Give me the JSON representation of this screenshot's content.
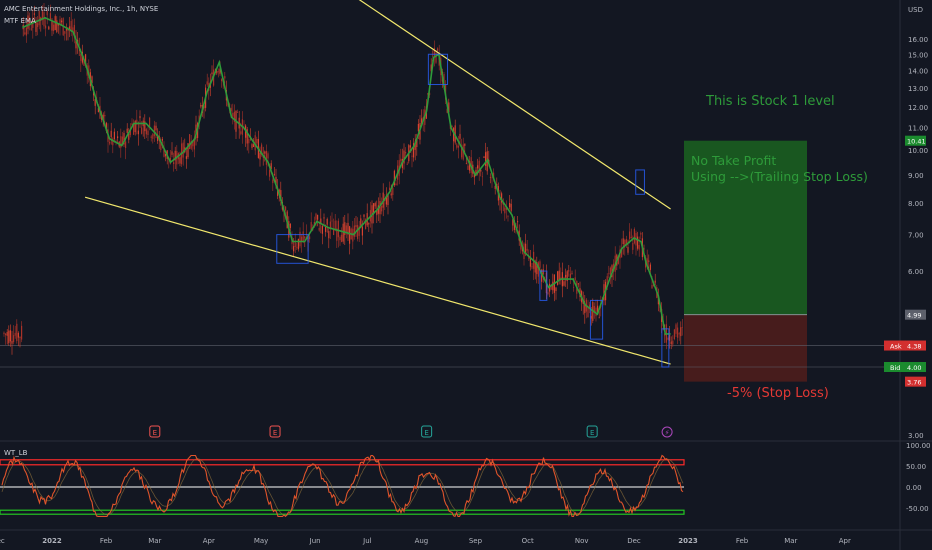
{
  "header": {
    "symbol": "AMC Entertainment Holdings, Inc., 1h, NYSE",
    "indicator": "MTF EMA",
    "oscillator": "WT_LB"
  },
  "annotations": {
    "stock_level": "This is Stock 1 level",
    "no_take_profit": "No Take Profit",
    "trailing": "Using -->(Trailing Stop Loss)",
    "stop_loss": "-5% (Stop Loss)"
  },
  "colors": {
    "background": "#131722",
    "candle": "#c0392b",
    "ema": "#2e9b3a",
    "trendline": "#f2e86d",
    "profit_zone": "#1b5e20",
    "loss_zone": "#4a1c1c",
    "wt_line": "#e0542b",
    "wt_upper": "#ff2a2a",
    "wt_lower": "#23c623",
    "wt_mid": "#ffffff",
    "marker_box": "#2962ff"
  },
  "chart_data": [
    {
      "type": "line",
      "series": [
        {
          "name": "MTF EMA",
          "x": [
            "2021-12-15",
            "2021-12-28",
            "2022-01-06",
            "2022-01-13",
            "2022-01-20",
            "2022-01-27",
            "2022-02-03",
            "2022-02-10",
            "2022-02-17",
            "2022-02-24",
            "2022-03-03",
            "2022-03-10",
            "2022-03-17",
            "2022-03-24",
            "2022-03-31",
            "2022-04-07",
            "2022-04-14",
            "2022-04-21",
            "2022-04-28",
            "2022-05-05",
            "2022-05-12",
            "2022-05-19",
            "2022-05-26",
            "2022-06-02",
            "2022-06-09",
            "2022-06-16",
            "2022-06-23",
            "2022-06-30",
            "2022-07-07",
            "2022-07-14",
            "2022-07-21",
            "2022-07-28",
            "2022-08-04",
            "2022-08-08",
            "2022-08-11",
            "2022-08-18",
            "2022-08-25",
            "2022-09-01",
            "2022-09-08",
            "2022-09-15",
            "2022-09-22",
            "2022-09-29",
            "2022-10-06",
            "2022-10-13",
            "2022-10-20",
            "2022-10-27",
            "2022-11-03",
            "2022-11-10",
            "2022-11-17",
            "2022-11-24",
            "2022-12-01",
            "2022-12-05",
            "2022-12-08",
            "2022-12-15",
            "2022-12-19",
            "2022-12-22"
          ],
          "values": [
            16.8,
            17.5,
            17.0,
            16.5,
            14.5,
            12.2,
            10.5,
            10.2,
            11.2,
            11.2,
            10.6,
            9.5,
            9.9,
            10.5,
            12.8,
            14.5,
            11.5,
            11.0,
            10.2,
            9.5,
            8.2,
            6.8,
            6.8,
            7.4,
            7.2,
            7.1,
            7.0,
            7.4,
            7.8,
            8.4,
            9.5,
            10.2,
            11.8,
            14.8,
            15.0,
            11.0,
            10.0,
            9.0,
            9.6,
            8.2,
            7.6,
            6.5,
            6.2,
            5.6,
            5.8,
            5.8,
            5.2,
            5.0,
            5.8,
            6.6,
            6.9,
            6.8,
            6.2,
            5.4,
            4.6,
            4.6
          ]
        }
      ],
      "yticks": [
        3.0,
        4.0,
        5.0,
        6.0,
        7.0,
        8.0,
        9.0,
        10.0,
        11.0,
        12.0,
        13.0,
        14.0,
        15.0,
        16.0
      ],
      "yaxis_unit": "USD",
      "xticks": [
        "Dec",
        "2022",
        "Feb",
        "Mar",
        "Apr",
        "May",
        "Jun",
        "Jul",
        "Aug",
        "Sep",
        "Oct",
        "Nov",
        "Dec",
        "2023",
        "Feb",
        "Mar",
        "Apr"
      ],
      "price_labels": [
        {
          "label": "",
          "value": "10.41",
          "color": "#1b8b2e"
        },
        {
          "label": "",
          "value": "4.99",
          "color": "#5d606b"
        },
        {
          "label": "Ask",
          "value": "4.38",
          "color": "#d32f2f"
        },
        {
          "label": "Bid",
          "value": "4.00",
          "color": "#1b8b2e"
        },
        {
          "label": "",
          "value": "3.76",
          "color": "#d32f2f"
        }
      ],
      "position": {
        "entry": 4.99,
        "target": 10.41,
        "stop": 3.76
      },
      "trendlines": [
        {
          "name": "descending resistance",
          "from": {
            "x": "2022-06-20",
            "y": 19.5
          },
          "to": {
            "x": "2022-12-22",
            "y": 7.8
          }
        },
        {
          "name": "support",
          "from": {
            "x": "2022-01-20",
            "y": 8.2
          },
          "to": {
            "x": "2022-12-22",
            "y": 4.05
          }
        }
      ],
      "event_markers": [
        {
          "x": "2022-03-01",
          "label": "E",
          "color": "#ef5350"
        },
        {
          "x": "2022-05-09",
          "label": "E",
          "color": "#ef5350"
        },
        {
          "x": "2022-08-04",
          "label": "E",
          "color": "#26a69a"
        },
        {
          "x": "2022-11-07",
          "label": "E",
          "color": "#26a69a"
        },
        {
          "x": "2022-12-20",
          "label": "⚡",
          "color": "#ab47bc"
        }
      ]
    },
    {
      "type": "line",
      "title": "WT_LB",
      "yticks": [
        100.0,
        50.0,
        0.0,
        -50.0
      ],
      "levels": {
        "overbought": 60,
        "mid": 0,
        "oversold": -60
      }
    }
  ]
}
